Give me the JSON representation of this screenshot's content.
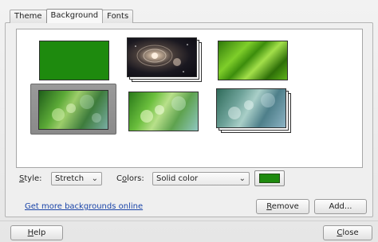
{
  "tabs": [
    {
      "label": "Theme"
    },
    {
      "label": "Background"
    },
    {
      "label": "Fonts"
    }
  ],
  "active_tab": "Background",
  "backgrounds": [
    {
      "name": "solid-green",
      "selected": false
    },
    {
      "name": "galaxy",
      "selected": false
    },
    {
      "name": "green-leaf",
      "selected": false
    },
    {
      "name": "green-bokeh",
      "selected": true
    },
    {
      "name": "green-bokeh-light",
      "selected": false
    },
    {
      "name": "teal-bokeh",
      "selected": false
    }
  ],
  "style": {
    "label_mnemonic": "S",
    "label_rest": "tyle:",
    "value": "Stretch"
  },
  "colors": {
    "label_pre": "C",
    "label_mnemonic": "o",
    "label_rest": "lors:",
    "value": "Solid color",
    "swatch_color": "#1e8a0e"
  },
  "link_text": "Get more backgrounds online",
  "buttons": {
    "remove_mnemonic": "R",
    "remove_rest": "emove",
    "add_label": "Add...",
    "help_mnemonic": "H",
    "help_rest": "elp",
    "close_mnemonic": "C",
    "close_rest": "lose"
  }
}
